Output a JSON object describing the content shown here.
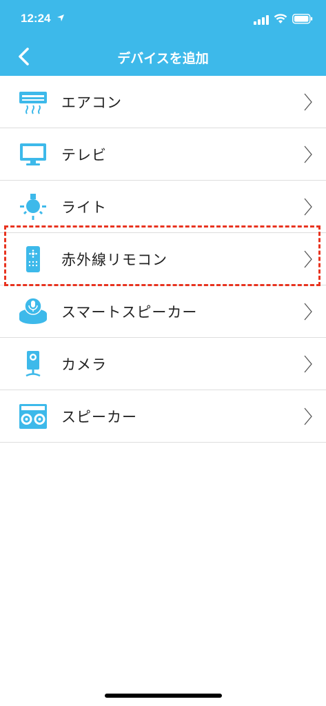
{
  "status_bar": {
    "time": "12:24"
  },
  "nav": {
    "title": "デバイスを追加"
  },
  "devices": [
    {
      "label": "エアコン",
      "icon": "air-conditioner-icon"
    },
    {
      "label": "テレビ",
      "icon": "tv-icon"
    },
    {
      "label": "ライト",
      "icon": "light-bulb-icon"
    },
    {
      "label": "赤外線リモコン",
      "icon": "ir-remote-icon"
    },
    {
      "label": "スマートスピーカー",
      "icon": "smart-speaker-icon"
    },
    {
      "label": "カメラ",
      "icon": "camera-icon"
    },
    {
      "label": "スピーカー",
      "icon": "speaker-icon"
    }
  ],
  "colors": {
    "header": "#3DB9EA",
    "icon": "#3DB9EA",
    "highlight": "#E8331F"
  }
}
